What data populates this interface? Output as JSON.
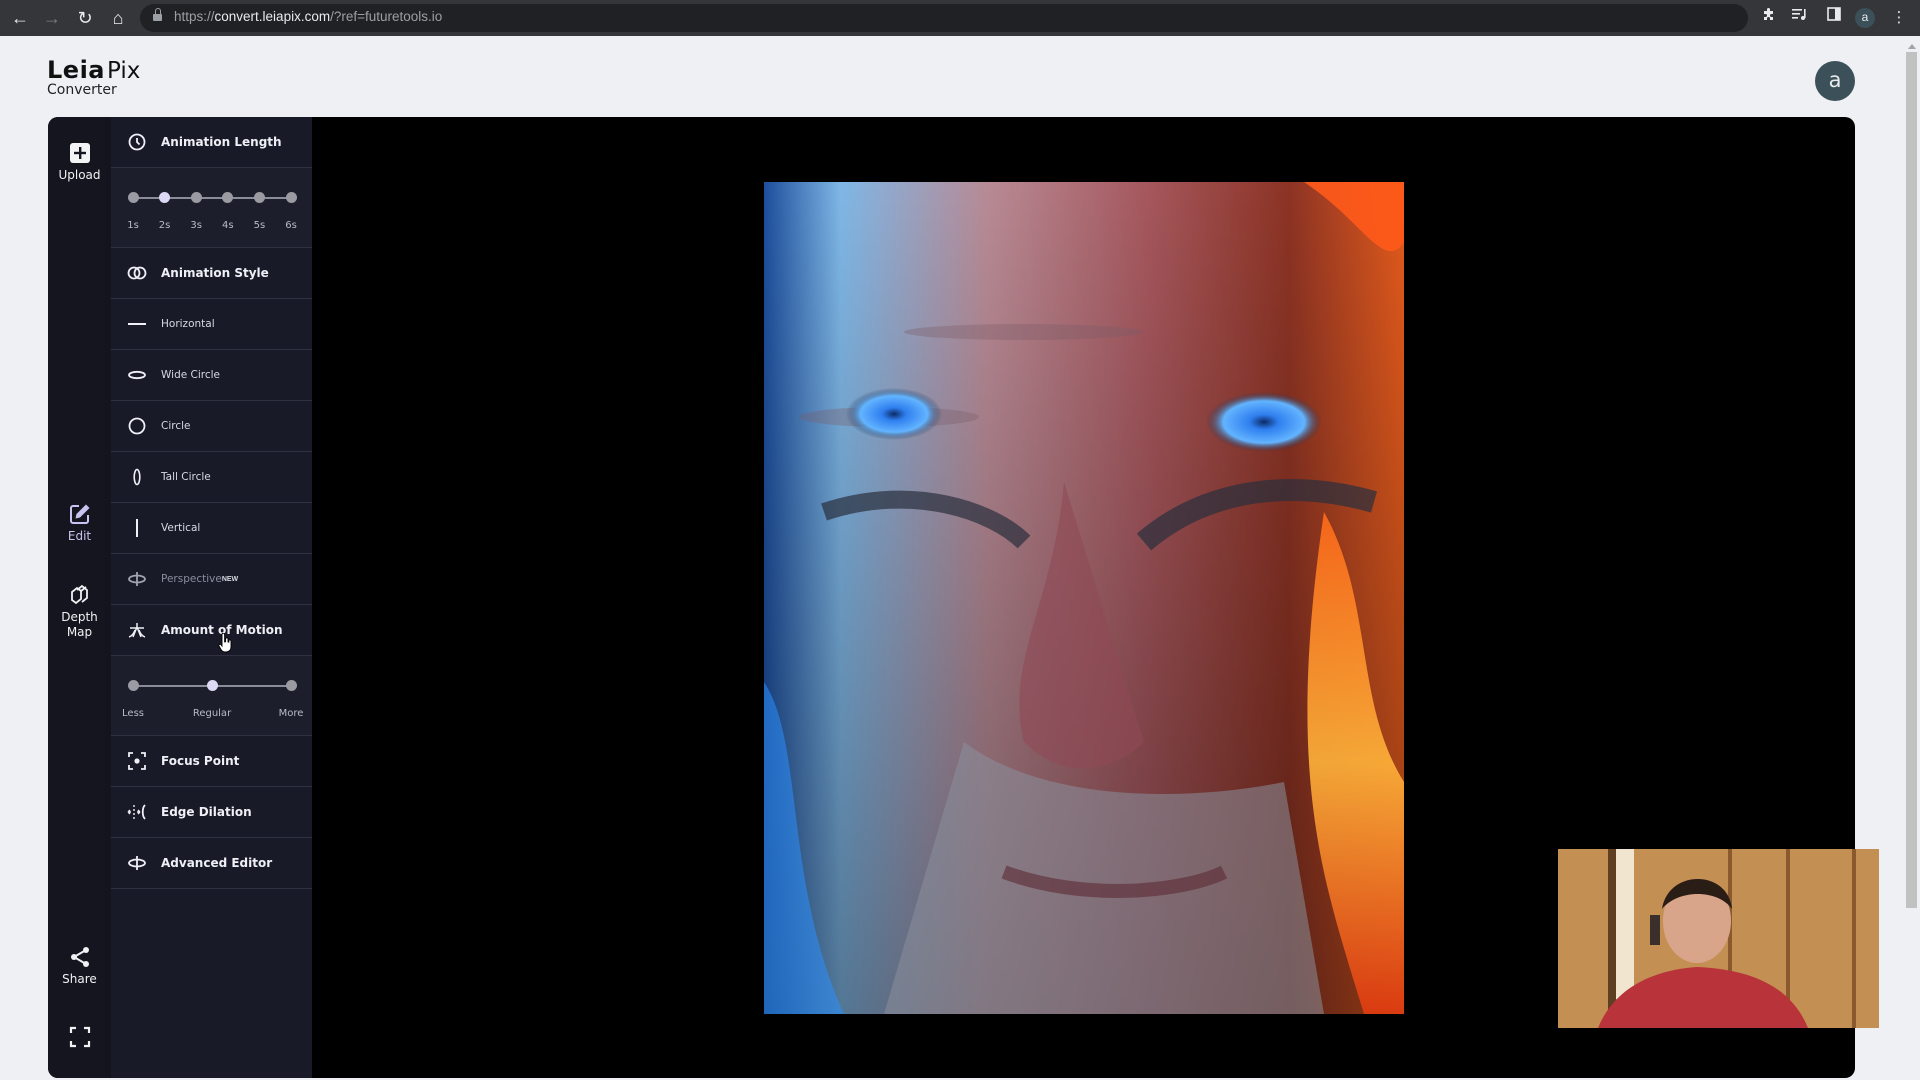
{
  "browser": {
    "url_scheme": "https://",
    "url_host": "convert.leiapix.com",
    "url_path": "/?ref=futuretools.io",
    "profile_initial": "a"
  },
  "header": {
    "logo_bold": "Leia",
    "logo_light": "Pix",
    "logo_sub": "Converter",
    "avatar_initial": "a"
  },
  "toolbar": {
    "upload": "Upload",
    "edit": "Edit",
    "depth_map_line1": "Depth",
    "depth_map_line2": "Map",
    "share": "Share"
  },
  "panel": {
    "animation_length": {
      "title": "Animation Length",
      "options": [
        "1s",
        "2s",
        "3s",
        "4s",
        "5s",
        "6s"
      ],
      "selected": "2s"
    },
    "animation_style": {
      "title": "Animation Style",
      "options": [
        {
          "label": "Horizontal",
          "icon": "horizontal-line-icon"
        },
        {
          "label": "Wide Circle",
          "icon": "wide-ellipse-icon"
        },
        {
          "label": "Circle",
          "icon": "circle-icon"
        },
        {
          "label": "Tall Circle",
          "icon": "tall-ellipse-icon"
        },
        {
          "label": "Vertical",
          "icon": "vertical-line-icon"
        },
        {
          "label": "Perspective",
          "icon": "perspective-icon",
          "badge": "NEW",
          "disabled": true
        }
      ]
    },
    "amount_of_motion": {
      "title": "Amount of Motion",
      "options": [
        "Less",
        "Regular",
        "More"
      ],
      "selected": "Regular"
    },
    "focus_point": "Focus Point",
    "edge_dilation": "Edge Dilation",
    "advanced_editor": "Advanced Editor"
  },
  "colors": {
    "toolbar_bg": "#15151f",
    "panel_bg": "#181a27",
    "accent_selected": "#dcd8f6",
    "avatar_bg": "#3b5058"
  }
}
